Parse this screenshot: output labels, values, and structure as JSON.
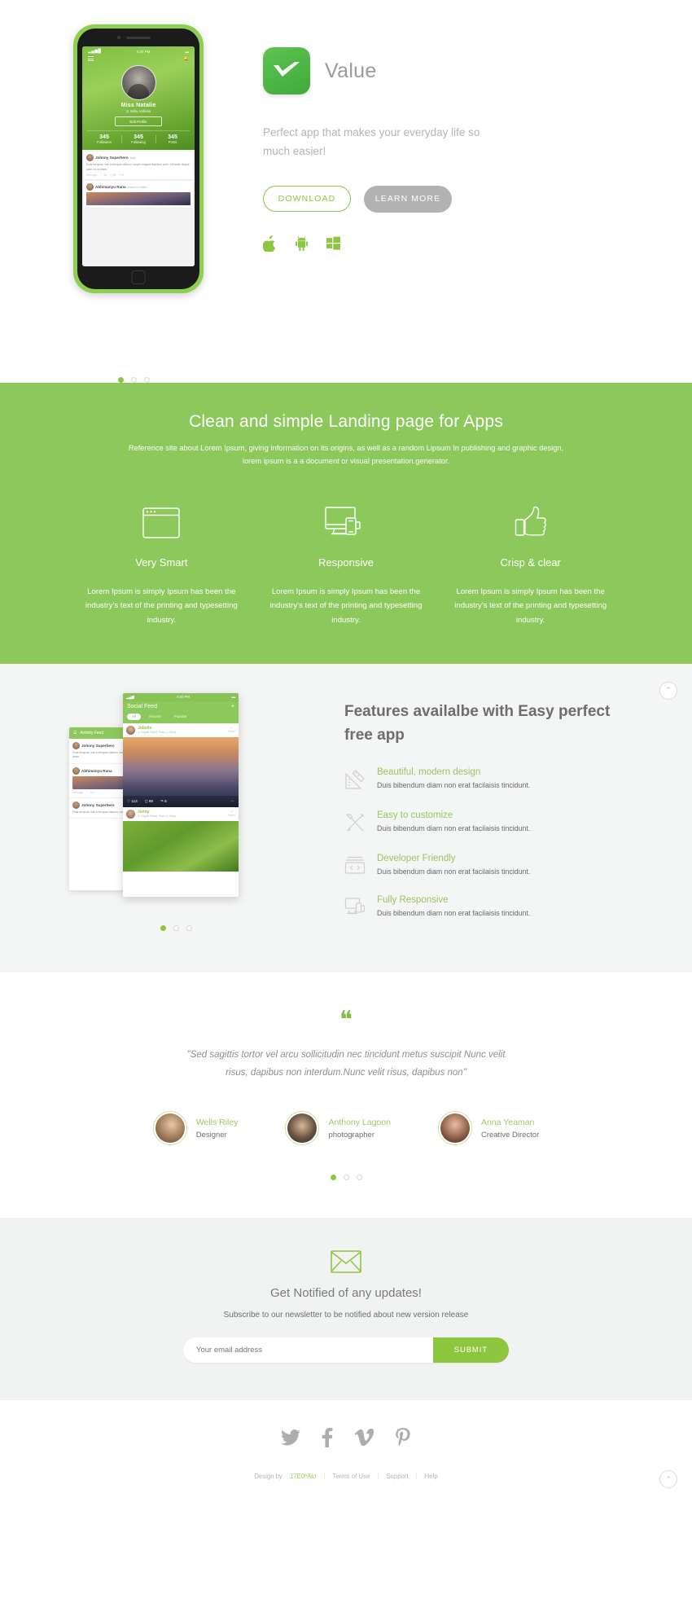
{
  "hero": {
    "brand_name": "Value",
    "tagline": "Perfect app that makes your everyday life so much easier!",
    "download_label": "DOWNLOAD",
    "learn_more_label": "LEARN MORE",
    "platforms": [
      "apple-icon",
      "android-icon",
      "windows-icon"
    ],
    "accent": "#8dc63f",
    "phone": {
      "time": "4:20 PM",
      "user_name": "Miss Natalie",
      "user_location": "India, Kolkata",
      "edit_profile_label": "Edit Profile",
      "stats": [
        {
          "value": "345",
          "label": "Followers"
        },
        {
          "value": "345",
          "label": "Following"
        },
        {
          "value": "345",
          "label": "Posts"
        }
      ],
      "posts": [
        {
          "author": "Johnny Superhero",
          "action": "says",
          "body": "Duis tempus, est a tempus dictum, turpis magna dapibus sem, ut scele risque odor mi id diam.",
          "time": "5mn ago",
          "likes": "93",
          "comments": "89",
          "shares": "6"
        },
        {
          "author": "Abhimanyu Rana",
          "action": "shared a Video",
          "body": "",
          "time": "",
          "likes": "",
          "comments": "",
          "shares": ""
        }
      ]
    }
  },
  "green_section": {
    "heading": "Clean and simple Landing page for Apps",
    "subtext": "Reference site about Lorem Ipsum, giving information on its origins, as well as a random Lipsum In publishing and graphic design, lorem ipsum is a a document or visual presentation.generator.",
    "background": "#8dc85c",
    "features": [
      {
        "icon": "browser-window-icon",
        "title": "Very Smart",
        "body": "Lorem Ipsum is simply Ipsum has been the industry's text of the printing and typesetting industry."
      },
      {
        "icon": "responsive-devices-icon",
        "title": "Responsive",
        "body": "Lorem Ipsum is simply Ipsum has been the industry's text of the printing and typesetting industry."
      },
      {
        "icon": "thumbs-up-icon",
        "title": "Crisp & clear",
        "body": "Lorem Ipsum is simply Ipsum has been the industry's text of the printing and typesetting industry."
      }
    ]
  },
  "features_section": {
    "heading": "Features availalbe with Easy perfect free app",
    "items": [
      {
        "icon": "ruler-triangle-icon",
        "title": "Beautiful, modern design",
        "body": "Duis bibendum diam non erat facilaisis tincidunt."
      },
      {
        "icon": "tools-icon",
        "title": "Easy to customize",
        "body": "Duis bibendum diam non erat facilaisis tincidunt."
      },
      {
        "icon": "code-window-icon",
        "title": "Developer Friendly",
        "body": "Duis bibendum diam non erat facilaisis tincidunt."
      },
      {
        "icon": "responsive-screen-icon",
        "title": "Fully Responsive",
        "body": "Duis bibendum diam non erat facilaisis tincidunt."
      }
    ],
    "mock_front": {
      "time": "4:20 PM",
      "title": "Social Feed",
      "tabs": [
        "All",
        "Recent",
        "Popular"
      ],
      "active_tab": "All",
      "cards": [
        {
          "name": "Juliette",
          "location": "Hayak Hotel, Paris (1.2km)",
          "time": "9mnn",
          "likes": "113",
          "comments": "89",
          "shares": "6"
        },
        {
          "name": "Jenny",
          "location": "Hayak Hotel, Paris (1.2km)",
          "time": "9mnn",
          "likes": "",
          "comments": "",
          "shares": ""
        }
      ]
    },
    "mock_back": {
      "title": "Activity Feed",
      "posts": [
        {
          "author": "Johnny Superhero",
          "body": "Duis tempus, est a tempus dictum, turpis magna dapibus sem, ut scele mi id diam.",
          "time": "5mn ago",
          "likes": "113"
        },
        {
          "author": "Abhimanyu Rana",
          "body": "",
          "time": "5mn ago",
          "likes": "113"
        },
        {
          "author": "Johnny Superhero",
          "body": "Duis tempus, est a tempus dictum, magna dapibus sem, ut scele mi id diam.",
          "time": "5mn ago",
          "likes": ""
        }
      ]
    },
    "scroll_top_icon": "chevron-up-icon"
  },
  "testimonials": {
    "quote_icon": "quote-mark-icon",
    "quote": "\"Sed sagittis tortor vel arcu sollicitudin nec tincidunt metus suscipit Nunc velit risus, dapibus non interdum.Nunc velit risus, dapibus non\"",
    "people": [
      {
        "name": "Wells Riley",
        "role": "Designer"
      },
      {
        "name": "Anthony Lagoon",
        "role": "photographer"
      },
      {
        "name": "Anna Yeaman",
        "role": "Creative Director"
      }
    ]
  },
  "newsletter": {
    "icon": "envelope-icon",
    "heading": "Get Notified of any updates!",
    "subtext": "Subscribe to our newsletter to be notified about new version release",
    "email_placeholder": "Your email address",
    "email_value": "",
    "submit_label": "SUBMIT"
  },
  "footer": {
    "socials": [
      "twitter-icon",
      "facebook-icon",
      "vimeo-icon",
      "pinterest-icon"
    ],
    "design_by_label": "Design by",
    "design_by_name": "17E0ªAlo",
    "links": [
      "Terms of Use",
      "Support",
      "Help"
    ],
    "scroll_top_icon": "chevron-up-icon"
  }
}
